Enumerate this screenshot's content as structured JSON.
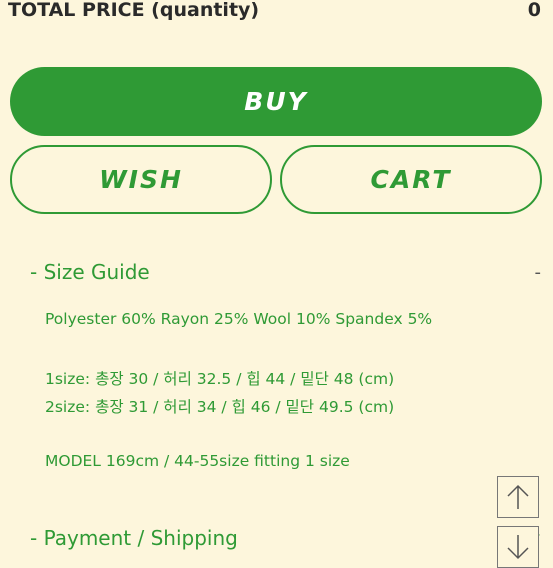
{
  "total": {
    "label": "TOTAL PRICE (quantity)",
    "value": "0"
  },
  "actions": {
    "buy_label": "BUY",
    "wish_label": "WISH",
    "cart_label": "CART"
  },
  "size_guide": {
    "title": "- Size Guide",
    "toggle": "-",
    "lines": [
      "Polyester 60% Rayon 25% Wool 10% Spandex 5%",
      "1size: 총장 30 / 허리 32.5 / 힙 44 / 밑단 48 (cm)",
      "2size: 총장 31 / 허리 34 / 힙 46 / 밑단 49.5 (cm)",
      "MODEL 169cm / 44-55size fitting 1 size"
    ]
  },
  "payment": {
    "title": "- Payment / Shipping",
    "plus": "+"
  },
  "scroll": {
    "up_icon": "arrow-up-icon",
    "down_icon": "arrow-down-icon"
  },
  "colors": {
    "accent": "#2f9a35",
    "background": "#fdf6dc"
  }
}
